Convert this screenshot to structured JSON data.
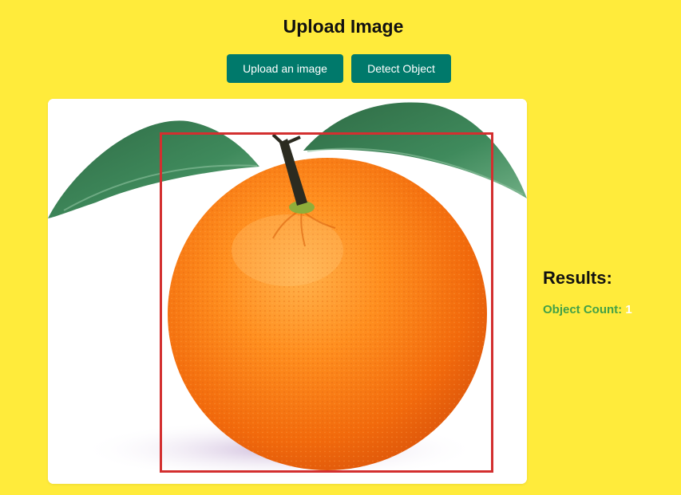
{
  "header": {
    "title": "Upload Image"
  },
  "toolbar": {
    "upload_label": "Upload an image",
    "detect_label": "Detect Object"
  },
  "preview": {
    "image_description_icon": "orange-fruit-photo",
    "detection_box_color": "#d32f2f"
  },
  "results": {
    "heading": "Results:",
    "count_label": "Object Count:",
    "count_value": "1"
  },
  "colors": {
    "background": "#ffeb3b",
    "button": "#00796b",
    "count_label": "#43a047",
    "count_value": "#ffffff"
  }
}
